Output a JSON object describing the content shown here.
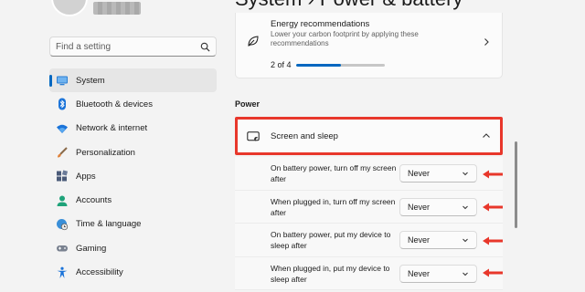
{
  "header": {
    "title": "System  ›  Power & battery"
  },
  "sidebar": {
    "search": {
      "placeholder": "Find a setting"
    },
    "items": [
      {
        "label": "System",
        "icon": "system-icon",
        "selected": true
      },
      {
        "label": "Bluetooth & devices",
        "icon": "bluetooth-icon"
      },
      {
        "label": "Network & internet",
        "icon": "wifi-icon"
      },
      {
        "label": "Personalization",
        "icon": "brush-icon"
      },
      {
        "label": "Apps",
        "icon": "apps-icon"
      },
      {
        "label": "Accounts",
        "icon": "accounts-icon"
      },
      {
        "label": "Time & language",
        "icon": "globe-clock-icon"
      },
      {
        "label": "Gaming",
        "icon": "gamepad-icon"
      },
      {
        "label": "Accessibility",
        "icon": "accessibility-icon"
      }
    ]
  },
  "energy": {
    "title": "Energy recommendations",
    "description": "Lower your carbon footprint by applying these recommendations",
    "progress_text": "2 of 4",
    "progress_value": 0.5
  },
  "power": {
    "section_label": "Power",
    "screen_sleep": {
      "label": "Screen and sleep",
      "settings": [
        {
          "label": "On battery power, turn off my screen after",
          "value": "Never"
        },
        {
          "label": "When plugged in, turn off my screen after",
          "value": "Never"
        },
        {
          "label": "On battery power, put my device to sleep after",
          "value": "Never"
        },
        {
          "label": "When plugged in, put my device to sleep after",
          "value": "Never"
        }
      ]
    }
  },
  "colors": {
    "accent": "#0067c0",
    "highlight": "#e8372b"
  }
}
